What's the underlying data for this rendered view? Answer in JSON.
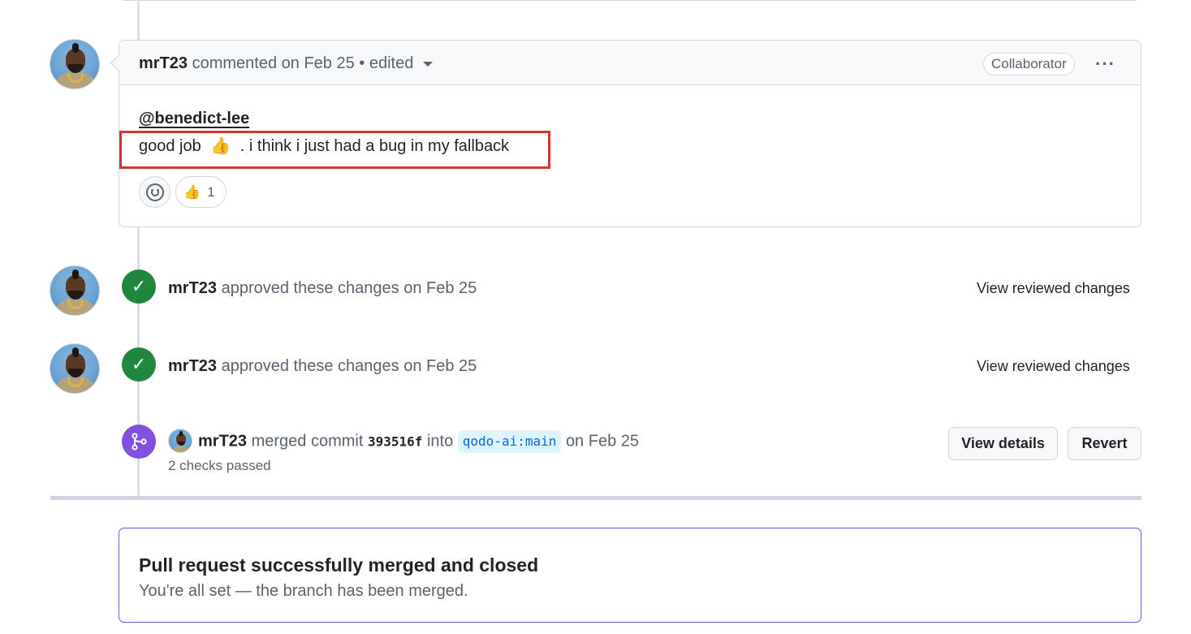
{
  "comment": {
    "author": "mrT23",
    "meta": "commented on Feb 25 • edited",
    "role_badge": "Collaborator",
    "more_menu": "···",
    "mention": "@benedict-lee",
    "body_prefix": "good job",
    "body_emoji": "👍",
    "body_suffix": ". i think i just had a bug in my fallback",
    "reaction": {
      "emoji": "👍",
      "count": "1"
    }
  },
  "approvals": [
    {
      "author": "mrT23",
      "text": "approved these changes on Feb 25",
      "link": "View reviewed changes"
    },
    {
      "author": "mrT23",
      "text": "approved these changes on Feb 25",
      "link": "View reviewed changes"
    }
  ],
  "merge_event": {
    "author": "mrT23",
    "verb": "merged commit",
    "sha": "393516f",
    "into": "into",
    "branch": "qodo-ai:main",
    "date": "on Feb 25",
    "checks": "2 checks passed",
    "view_details": "View details",
    "revert": "Revert"
  },
  "merged_box": {
    "title": "Pull request successfully merged and closed",
    "subtitle": "You're all set — the branch has been merged."
  },
  "colors": {
    "success_green": "#1f883d",
    "merged_purple": "#8250df",
    "highlight_red": "#d63434",
    "link_blue": "#0969da"
  },
  "icons": {
    "check": "check-icon",
    "merge": "git-merge-icon",
    "smiley": "smiley-icon",
    "kebab": "kebab-horizontal-icon"
  }
}
